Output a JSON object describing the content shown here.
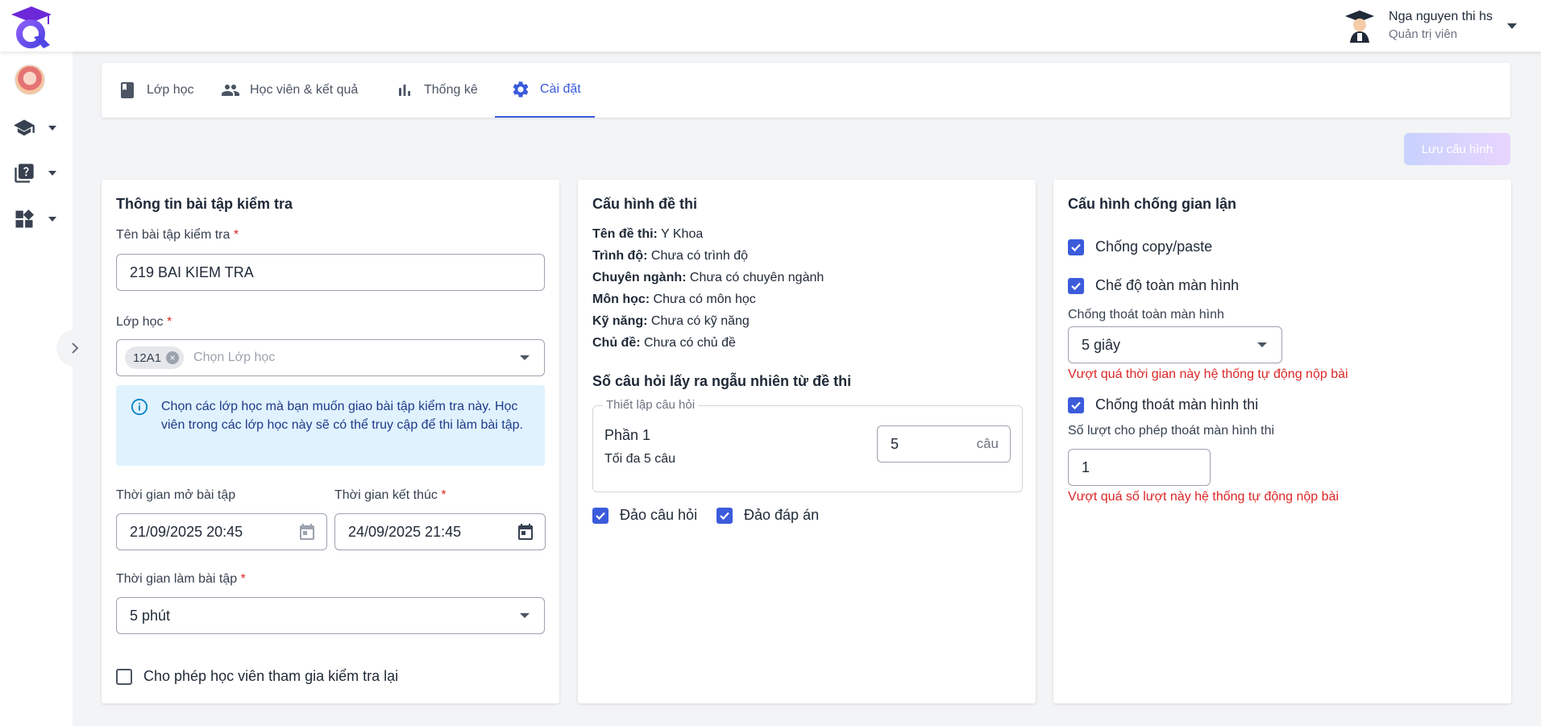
{
  "user": {
    "name": "Nga nguyen thi hs",
    "role": "Quản trị viên"
  },
  "tabs": [
    {
      "label": "Lớp học",
      "icon": "book-icon"
    },
    {
      "label": "Học viên & kết quả",
      "icon": "people-icon"
    },
    {
      "label": "Thống kê",
      "icon": "bar-chart-icon"
    },
    {
      "label": "Cài đặt",
      "icon": "gear-icon",
      "active": true
    }
  ],
  "toolbar": {
    "save_label": "Lưu cấu hình"
  },
  "info_card": {
    "title": "Thông tin bài tập kiểm tra",
    "name_label": "Tên bài tập kiểm tra",
    "name_value": "219 BAI KIEM TRA",
    "class_label": "Lớp học",
    "class_chip": "12A1",
    "class_placeholder": "Chọn Lớp học",
    "info_text": "Chọn các lớp học mà bạn muốn giao bài tập kiểm tra này. Học viên trong các lớp học này sẽ có thể truy cập để thi làm bài tập.",
    "start_label": "Thời gian mở bài tập",
    "start_value": "21/09/2025 20:45",
    "end_label": "Thời gian kết thúc",
    "end_value": "24/09/2025 21:45",
    "duration_label": "Thời gian làm bài tập",
    "duration_value": "5 phút",
    "retake_label": "Cho phép học viên tham gia kiểm tra lại",
    "required_mark": "*"
  },
  "exam_card": {
    "title": "Cấu hình đề thi",
    "fields": [
      {
        "key": "Tên đề thi:",
        "value": "Y Khoa"
      },
      {
        "key": "Trình độ:",
        "value": "Chưa có trình độ"
      },
      {
        "key": "Chuyên ngành:",
        "value": "Chưa có chuyên ngành"
      },
      {
        "key": "Môn học:",
        "value": "Chưa có môn học"
      },
      {
        "key": "Kỹ năng:",
        "value": "Chưa có kỹ năng"
      },
      {
        "key": "Chủ đề:",
        "value": "Chưa có chủ đề"
      }
    ],
    "random_title": "Số câu hỏi lấy ra ngẫu nhiên từ đề thi",
    "legend": "Thiết lập câu hỏi",
    "part_name": "Phần 1",
    "part_max": "Tối đa 5 câu",
    "part_count": "5",
    "part_unit": "câu",
    "shuffle_questions": "Đảo câu hỏi",
    "shuffle_answers": "Đảo đáp án"
  },
  "anticheat_card": {
    "title": "Cấu hình chống gian lận",
    "copy_paste": "Chống copy/paste",
    "fullscreen": "Chế độ toàn màn hình",
    "exit_fullscreen_label": "Chống thoát toàn màn hình",
    "exit_fullscreen_value": "5 giây",
    "exit_fullscreen_error": "Vượt quá thời gian này hệ thống tự động nộp bài",
    "exit_screen": "Chống thoát màn hình thi",
    "exit_count_label": "Số lượt cho phép thoát màn hình thi",
    "exit_count_value": "1",
    "exit_count_error": "Vượt quá số lượt này hệ thống tự động nộp bài"
  },
  "colors": {
    "accent": "#3b5bdb",
    "error": "#dc2626",
    "info_bg": "#e0f2fe"
  }
}
